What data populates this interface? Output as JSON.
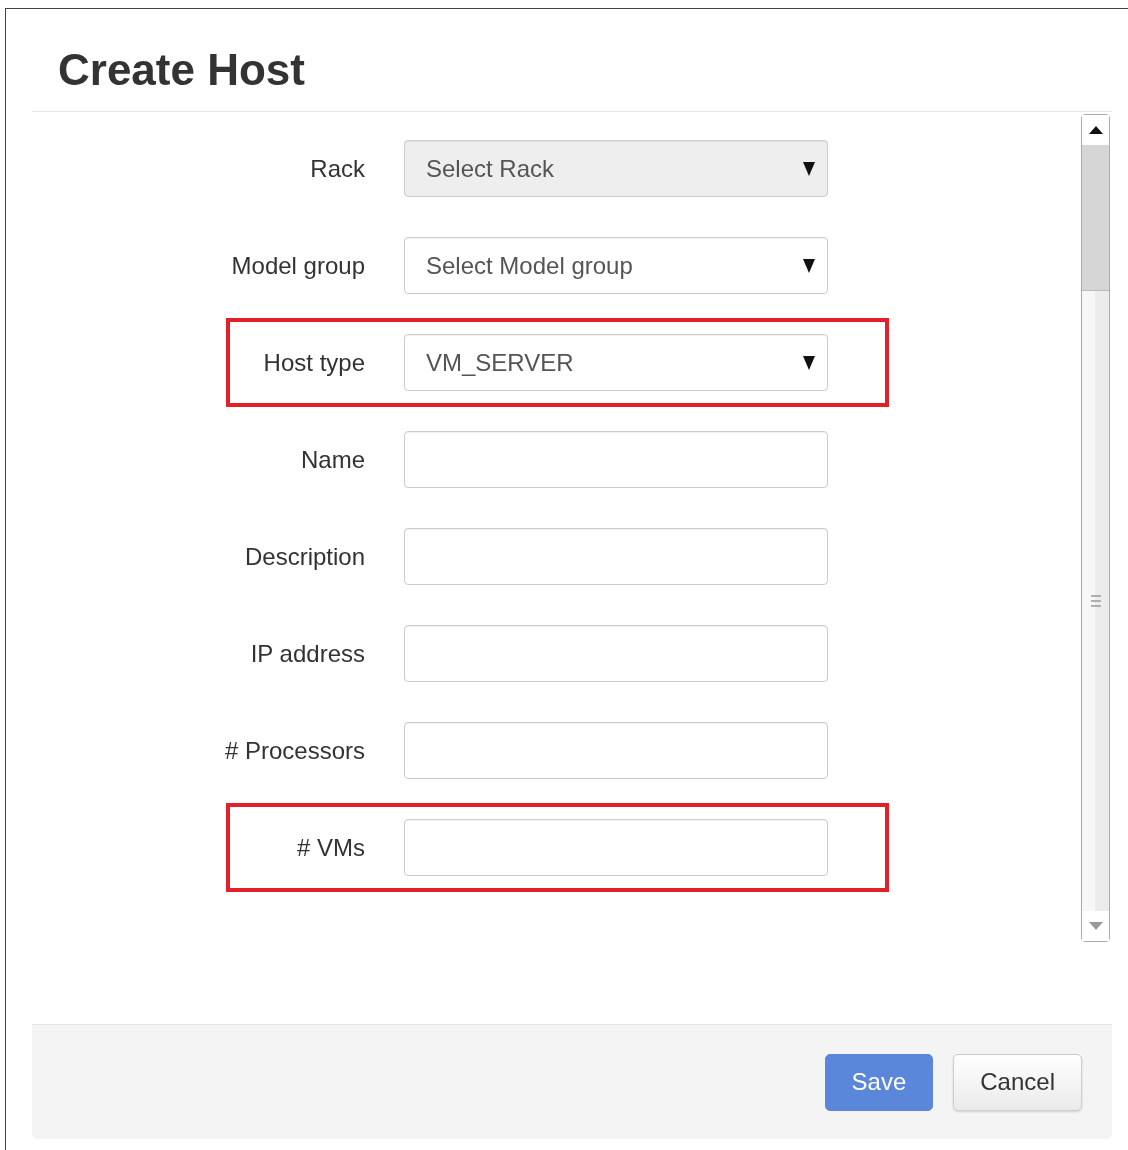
{
  "dialog": {
    "title": "Create Host"
  },
  "fields": [
    {
      "kind": "select",
      "label": "Rack",
      "value": "Select Rack",
      "disabled": true,
      "highlighted": false
    },
    {
      "kind": "select",
      "label": "Model group",
      "value": "Select Model group",
      "disabled": false,
      "highlighted": false
    },
    {
      "kind": "select",
      "label": "Host type",
      "value": "VM_SERVER",
      "disabled": false,
      "highlighted": true
    },
    {
      "kind": "text",
      "label": "Name",
      "highlighted": false
    },
    {
      "kind": "text",
      "label": "Description",
      "highlighted": false
    },
    {
      "kind": "text",
      "label": "IP address",
      "highlighted": false
    },
    {
      "kind": "text",
      "label": "# Processors",
      "highlighted": false
    },
    {
      "kind": "text",
      "label": "# VMs",
      "highlighted": true
    }
  ],
  "buttons": [
    {
      "kind": "primary",
      "label": "Save"
    },
    {
      "kind": "default",
      "label": "Cancel"
    }
  ]
}
